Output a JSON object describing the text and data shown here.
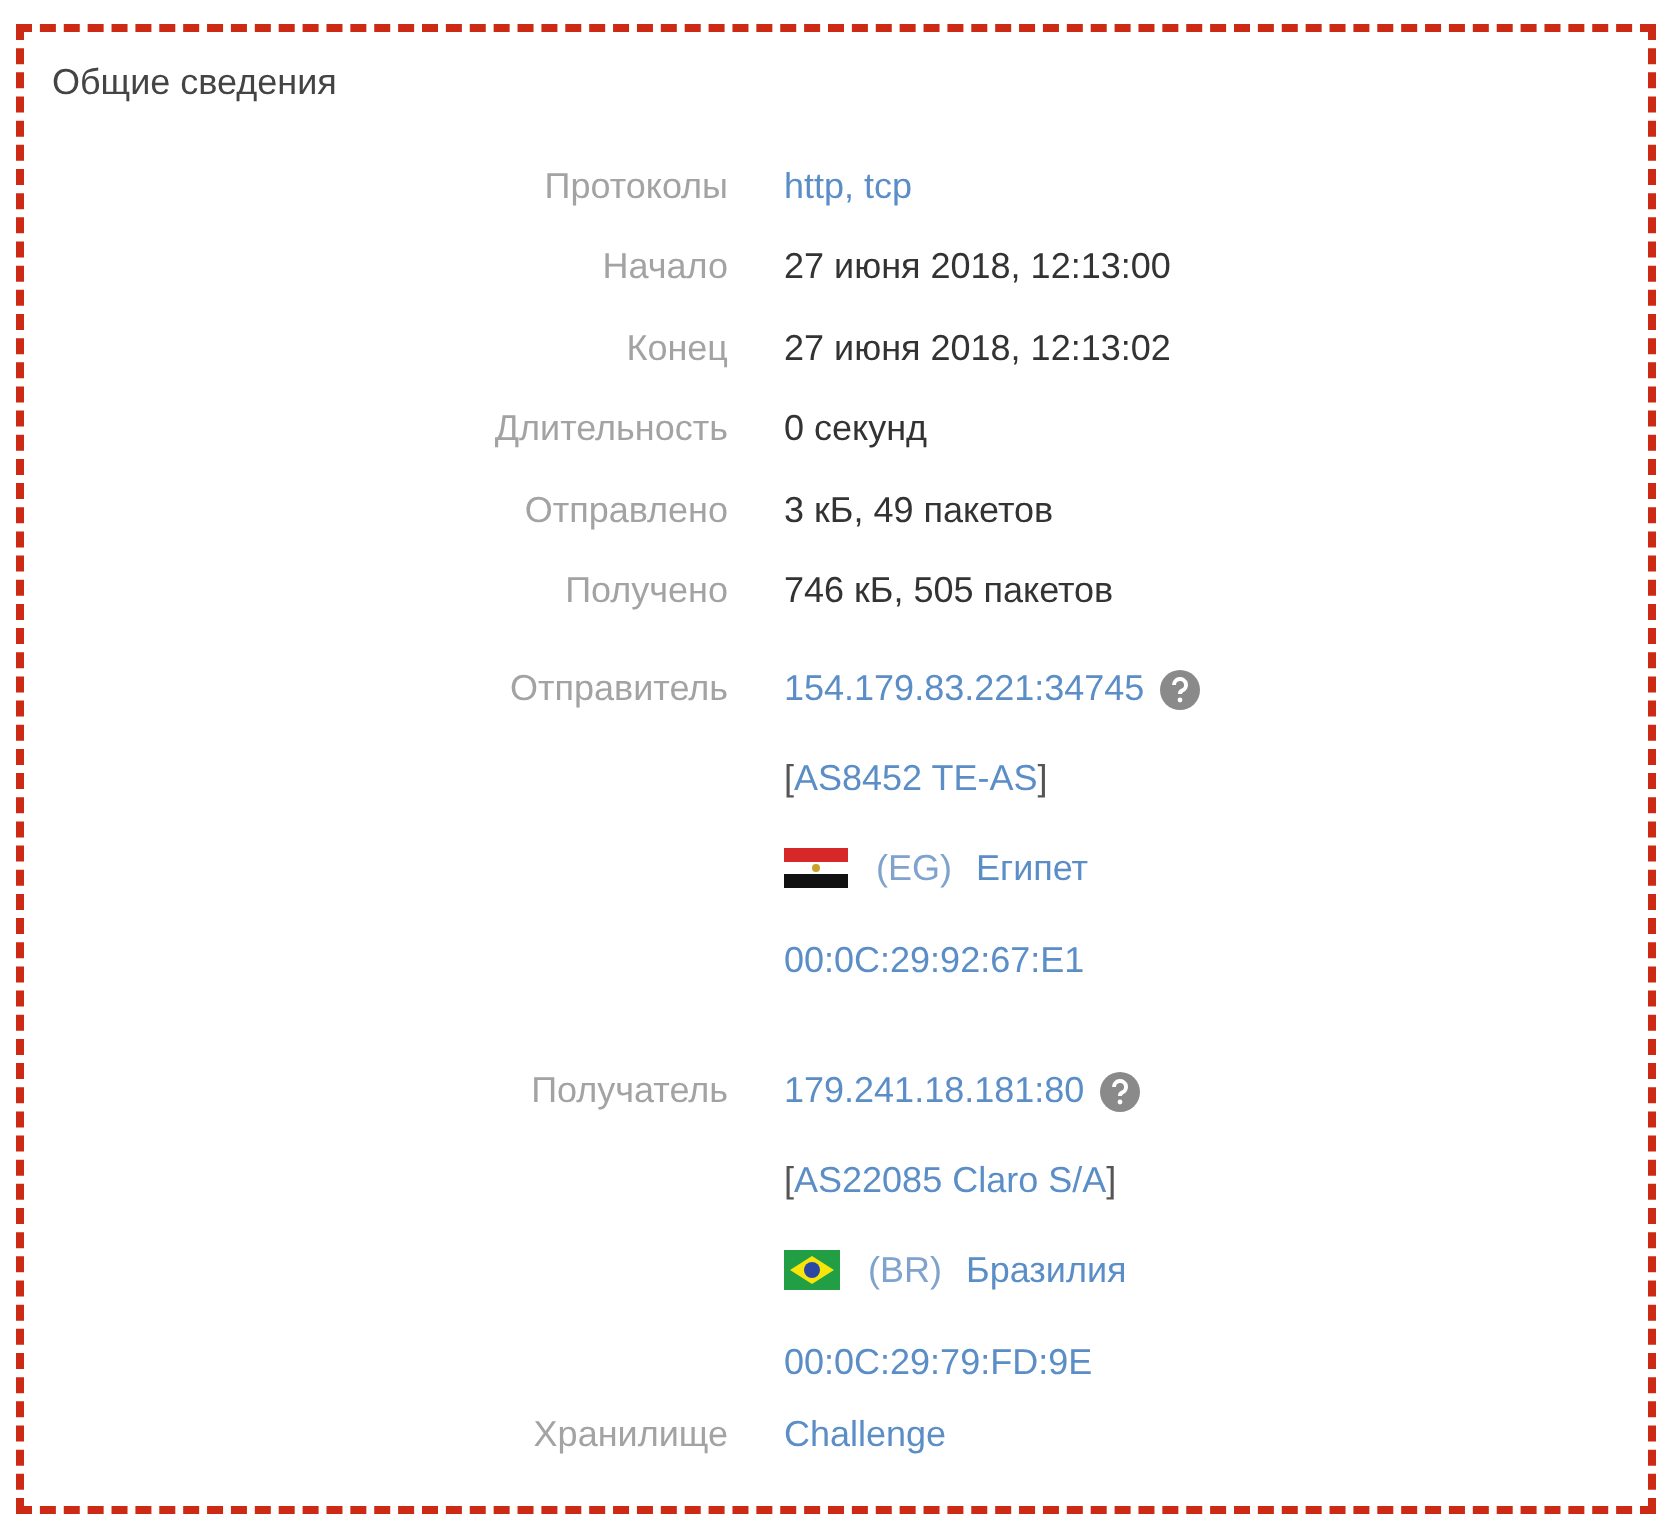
{
  "title": "Общие сведения",
  "rows": [
    {
      "label": "Протоколы",
      "kind": "link",
      "value": "http, tcp"
    },
    {
      "label": "Начало",
      "kind": "text",
      "value": "27 июня 2018, 12:13:00"
    },
    {
      "label": "Конец",
      "kind": "text",
      "value": "27 июня 2018, 12:13:02"
    },
    {
      "label": "Длительность",
      "kind": "text",
      "value": "0 секунд"
    },
    {
      "label": "Отправлено",
      "kind": "text",
      "value": "3 кБ, 49 пакетов"
    },
    {
      "label": "Получено",
      "kind": "text",
      "value": "746 кБ, 505 пакетов"
    }
  ],
  "hosts": [
    {
      "label": "Отправитель",
      "address": "154.179.83.221:34745",
      "bracket_open": "[",
      "as": "AS8452 TE-AS",
      "bracket_close": "]",
      "flag": {
        "kind": "eg"
      },
      "country_code": "(EG)",
      "country": "Египет",
      "mac": "00:0C:29:92:67:E1"
    },
    {
      "label": "Получатель",
      "address": "179.241.18.181:80",
      "bracket_open": "[",
      "as": "AS22085 Claro S/A",
      "bracket_close": "]",
      "flag": {
        "kind": "br"
      },
      "country_code": "(BR)",
      "country": "Бразилия",
      "mac": "00:0C:29:79:FD:9E"
    }
  ],
  "storage": {
    "label": "Хранилище",
    "value": "Challenge"
  }
}
